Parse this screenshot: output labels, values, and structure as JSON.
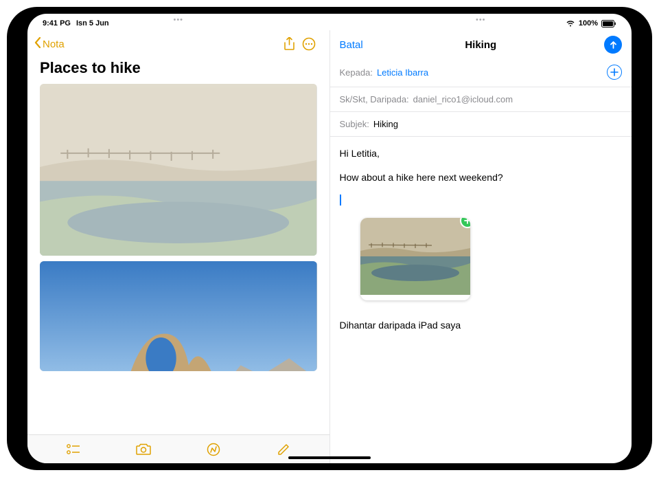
{
  "status": {
    "time": "9:41 PG",
    "date": "Isn 5 Jun",
    "battery": "100%"
  },
  "notes": {
    "back_label": "Nota",
    "title": "Places to hike"
  },
  "mail": {
    "cancel_label": "Batal",
    "title": "Hiking",
    "to_label": "Kepada:",
    "to_value": "Leticia Ibarra",
    "from_label": "Sk/Skt, Daripada:",
    "from_value": "daniel_rico1@icloud.com",
    "subject_label": "Subjek:",
    "subject_value": "Hiking",
    "body_greeting": "Hi Letitia,",
    "body_line2": "How about a hike here next weekend?",
    "signature": "Dihantar daripada iPad saya"
  },
  "icons": {
    "chevron_left": "chevron-left-icon",
    "share": "share-icon",
    "more": "more-icon",
    "checklist": "checklist-icon",
    "camera": "camera-icon",
    "markup": "markup-icon",
    "compose": "compose-icon",
    "send": "send-icon",
    "add_contact": "add-contact-icon",
    "wifi": "wifi-icon",
    "battery": "battery-icon",
    "add_attachment": "add-attachment-icon"
  }
}
